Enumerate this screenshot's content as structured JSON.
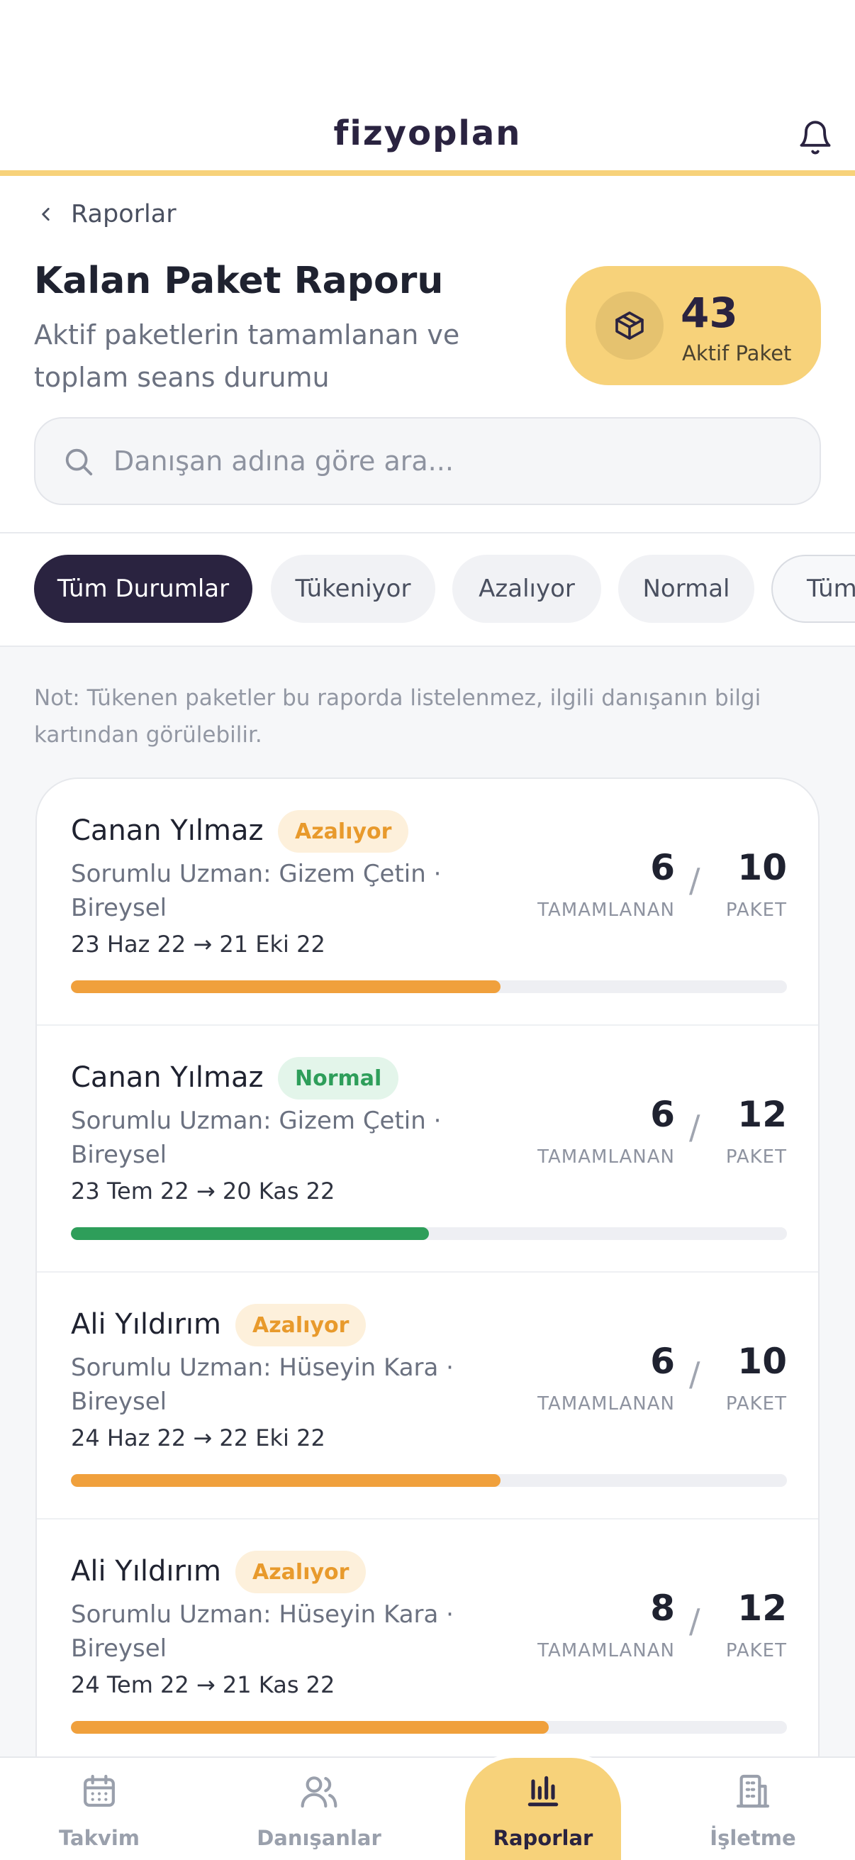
{
  "app": {
    "brand": "fizyoplan"
  },
  "nav": {
    "back_label": "Raporlar"
  },
  "header": {
    "title": "Kalan Paket Raporu",
    "subtitle": "Aktif paketlerin tamamlanan ve toplam seans durumu"
  },
  "stat": {
    "value": "43",
    "label": "Aktif Paket",
    "icon": "box-icon"
  },
  "search": {
    "placeholder": "Danışan adına göre ara...",
    "value": ""
  },
  "filters": [
    {
      "label": "Tüm Durumlar",
      "active": true
    },
    {
      "label": "Tükeniyor",
      "active": false
    },
    {
      "label": "Azalıyor",
      "active": false
    },
    {
      "label": "Normal",
      "active": false
    },
    {
      "label": "Tüm",
      "active": false
    }
  ],
  "note": "Not: Tükenen paketler bu raporda listelenmez, ilgili danışanın bilgi kartından görülebilir.",
  "labels": {
    "completed": "TAMAMLANAN",
    "package": "PAKET",
    "separator": "/"
  },
  "packages": [
    {
      "name": "Canan Yılmaz",
      "status": "Azalıyor",
      "status_type": "warn",
      "expert": "Sorumlu Uzman: Gizem Çetin ·",
      "type": "Bireysel",
      "dates": "23 Haz 22 → 21 Eki 22",
      "completed": "6",
      "total": "10",
      "progress": 0.6,
      "color": "#F0A03C"
    },
    {
      "name": "Canan Yılmaz",
      "status": "Normal",
      "status_type": "ok",
      "expert": "Sorumlu Uzman: Gizem Çetin ·",
      "type": "Bireysel",
      "dates": "23 Tem 22 → 20 Kas 22",
      "completed": "6",
      "total": "12",
      "progress": 0.5,
      "color": "#2E9E5A"
    },
    {
      "name": "Ali Yıldırım",
      "status": "Azalıyor",
      "status_type": "warn",
      "expert": "Sorumlu Uzman: Hüseyin Kara ·",
      "type": "Bireysel",
      "dates": "24 Haz 22 → 22 Eki 22",
      "completed": "6",
      "total": "10",
      "progress": 0.6,
      "color": "#F0A03C"
    },
    {
      "name": "Ali Yıldırım",
      "status": "Azalıyor",
      "status_type": "warn",
      "expert": "Sorumlu Uzman: Hüseyin Kara ·",
      "type": "Bireysel",
      "dates": "24 Tem 22 → 21 Kas 22",
      "completed": "8",
      "total": "12",
      "progress": 0.667,
      "color": "#F0A03C"
    }
  ],
  "tabs": [
    {
      "label": "Takvim",
      "icon": "calendar-icon",
      "active": false
    },
    {
      "label": "Danışanlar",
      "icon": "users-icon",
      "active": false
    },
    {
      "label": "Raporlar",
      "icon": "bar-chart-icon",
      "active": true
    },
    {
      "label": "İşletme",
      "icon": "building-icon",
      "active": false
    }
  ],
  "colors": {
    "accent": "#F7D27A",
    "dark": "#2A2340",
    "warn": "#F0A03C",
    "ok": "#2E9E5A"
  }
}
